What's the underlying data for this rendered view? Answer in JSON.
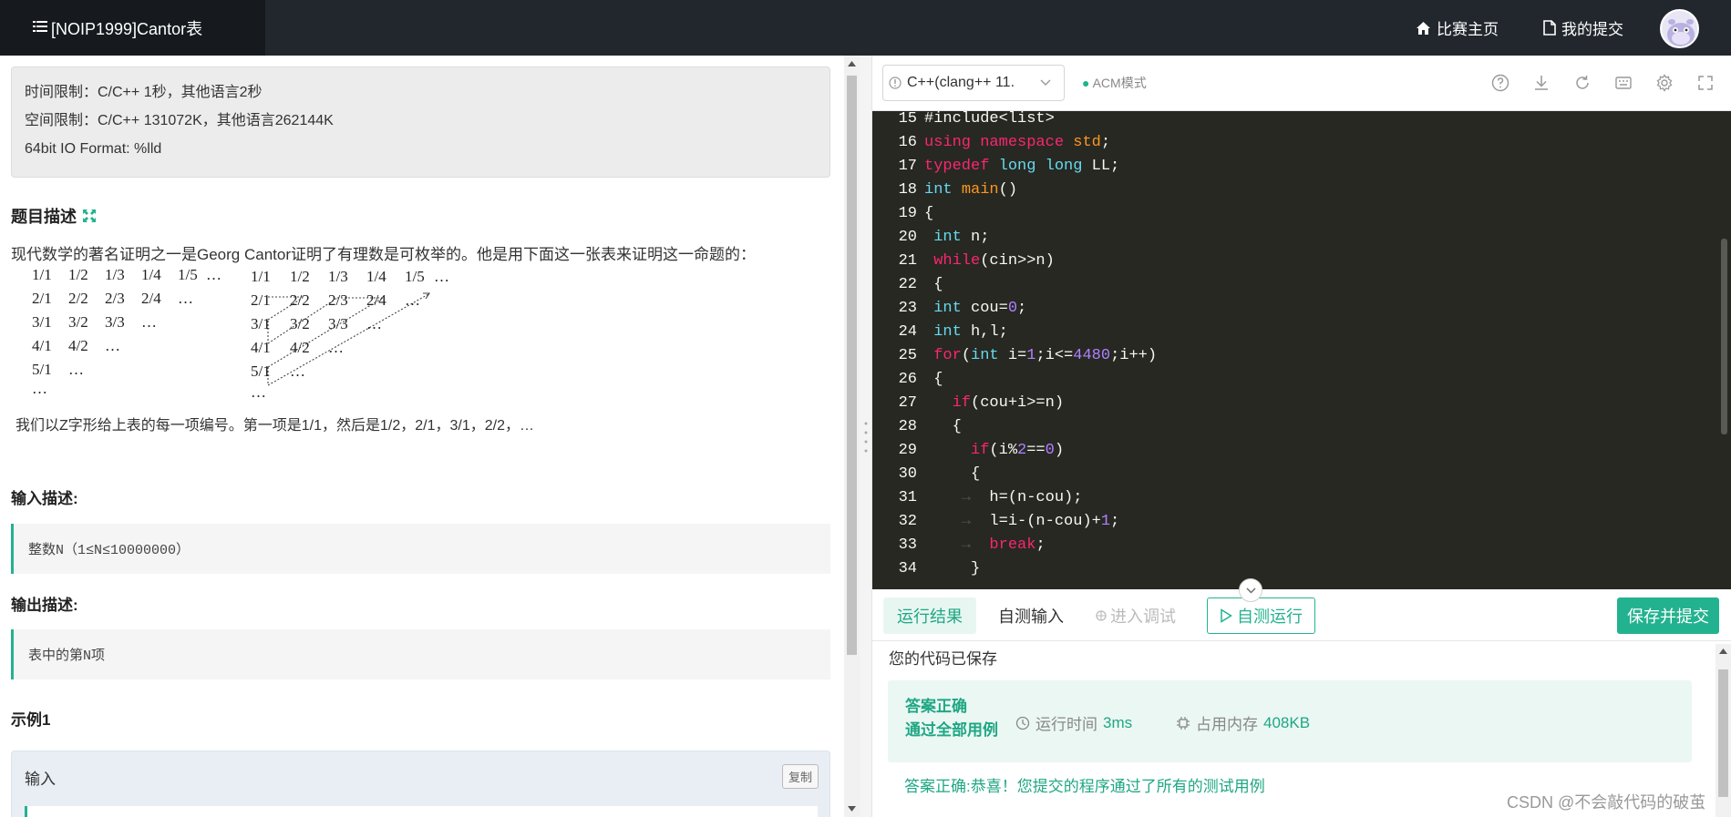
{
  "header": {
    "title": "[NOIP1999]Cantor表",
    "nav_home": "比赛主页",
    "nav_submissions": "我的提交"
  },
  "problem": {
    "limits": [
      "时间限制：C/C++ 1秒，其他语言2秒",
      "空间限制：C/C++ 131072K，其他语言262144K",
      "64bit IO Format: %lld"
    ],
    "desc_title": "题目描述",
    "desc_text": "现代数学的著名证明之一是Georg Cantor证明了有理数是可枚举的。他是用下面这一张表来证明这一命题的：",
    "table1": [
      [
        "1/1",
        "1/2",
        "1/3",
        "1/4",
        "1/5",
        "…"
      ],
      [
        "2/1",
        "2/2",
        "2/3",
        "2/4",
        "…"
      ],
      [
        "3/1",
        "3/2",
        "3/3",
        "…"
      ],
      [
        "4/1",
        "4/2",
        "…"
      ],
      [
        "5/1",
        "…"
      ],
      [
        "…"
      ]
    ],
    "table2": [
      [
        "1/1",
        "1/2",
        "1/3",
        "1/4",
        "1/5",
        "…"
      ],
      [
        "2/1",
        "2/2",
        "2/3",
        "2/4",
        "…"
      ],
      [
        "3/1",
        "3/2",
        "3/3",
        "…"
      ],
      [
        "4/1",
        "4/2",
        "…"
      ],
      [
        "5/1",
        "…"
      ],
      [
        "…"
      ]
    ],
    "desc_text2": "我们以Z字形给上表的每一项编号。第一项是1/1，然后是1/2，2/1，3/1，2/2，…",
    "input_title": "输入描述:",
    "input_text": "整数N（1≤N≤10000000）",
    "output_title": "输出描述:",
    "output_text": "表中的第N项",
    "example_title": "示例1",
    "sample_input_label": "输入",
    "copy_label": "复制"
  },
  "editor": {
    "language": "C++(clang++ 11.",
    "mode": "ACM模式"
  },
  "bottom": {
    "tab_result": "运行结果",
    "tab_custom_input": "自测输入",
    "tab_debug": "进入调试",
    "run_button": "自测运行",
    "submit_button": "保存并提交",
    "saved_msg": "您的代码已保存",
    "result_status": "答案正确",
    "result_cases": "通过全部用例",
    "time_label": "运行时间",
    "time_value": "3ms",
    "mem_label": "占用内存",
    "mem_value": "408KB",
    "result_msg": "答案正确:恭喜！您提交的程序通过了所有的测试用例"
  },
  "watermark": "CSDN @不会敲代码的破茧",
  "colors": {
    "accent": "#23b28f",
    "editor_bg": "#272822",
    "topbar_bg": "#22272e"
  }
}
